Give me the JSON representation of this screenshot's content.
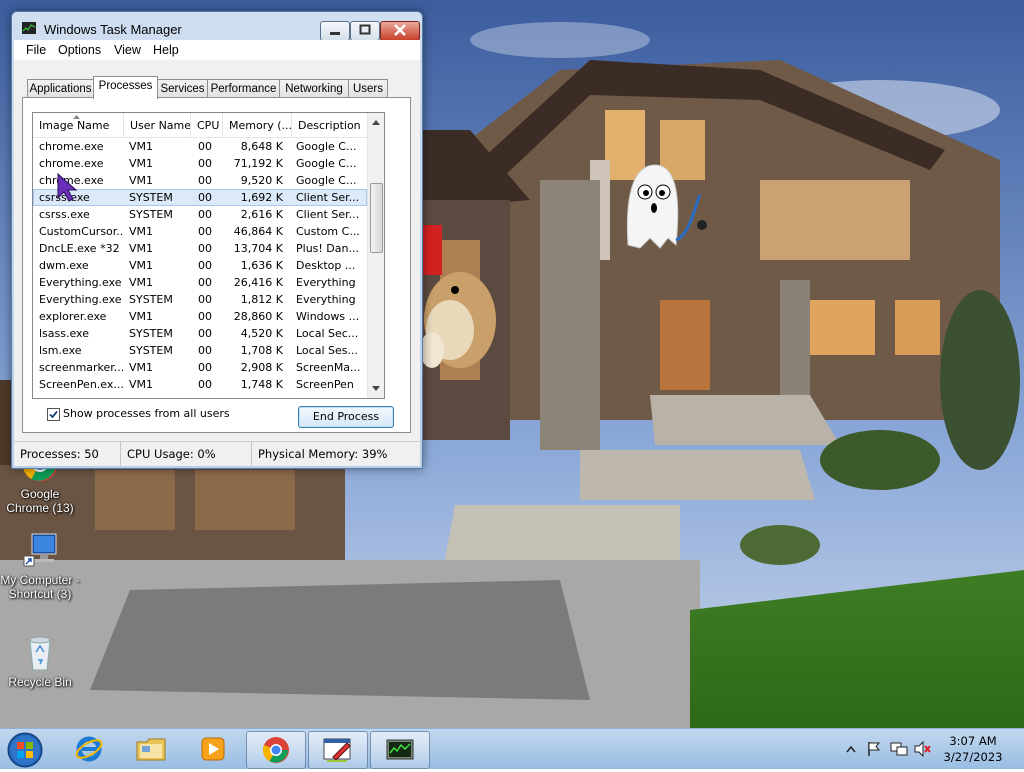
{
  "window": {
    "title": "Windows Task Manager",
    "menu": [
      "File",
      "Options",
      "View",
      "Help"
    ],
    "tabs": [
      "Applications",
      "Processes",
      "Services",
      "Performance",
      "Networking",
      "Users"
    ],
    "active_tab": "Processes"
  },
  "processes": {
    "columns": [
      "Image Name",
      "User Name",
      "CPU",
      "Memory (...",
      "Description"
    ],
    "sort_column": "Image Name",
    "selected_row": 3,
    "rows": [
      {
        "name": "chrome.exe",
        "user": "VM1",
        "cpu": "00",
        "mem": "8,648 K",
        "desc": "Google C..."
      },
      {
        "name": "chrome.exe",
        "user": "VM1",
        "cpu": "00",
        "mem": "71,192 K",
        "desc": "Google C..."
      },
      {
        "name": "chrome.exe",
        "user": "VM1",
        "cpu": "00",
        "mem": "9,520 K",
        "desc": "Google C..."
      },
      {
        "name": "csrss.exe",
        "user": "SYSTEM",
        "cpu": "00",
        "mem": "1,692 K",
        "desc": "Client Ser..."
      },
      {
        "name": "csrss.exe",
        "user": "SYSTEM",
        "cpu": "00",
        "mem": "2,616 K",
        "desc": "Client Ser..."
      },
      {
        "name": "CustomCursor...",
        "user": "VM1",
        "cpu": "00",
        "mem": "46,864 K",
        "desc": "Custom C..."
      },
      {
        "name": "DncLE.exe *32",
        "user": "VM1",
        "cpu": "00",
        "mem": "13,704 K",
        "desc": "Plus! Dan..."
      },
      {
        "name": "dwm.exe",
        "user": "VM1",
        "cpu": "00",
        "mem": "1,636 K",
        "desc": "Desktop ..."
      },
      {
        "name": "Everything.exe",
        "user": "VM1",
        "cpu": "00",
        "mem": "26,416 K",
        "desc": "Everything"
      },
      {
        "name": "Everything.exe",
        "user": "SYSTEM",
        "cpu": "00",
        "mem": "1,812 K",
        "desc": "Everything"
      },
      {
        "name": "explorer.exe",
        "user": "VM1",
        "cpu": "00",
        "mem": "28,860 K",
        "desc": "Windows ..."
      },
      {
        "name": "lsass.exe",
        "user": "SYSTEM",
        "cpu": "00",
        "mem": "4,520 K",
        "desc": "Local Sec..."
      },
      {
        "name": "lsm.exe",
        "user": "SYSTEM",
        "cpu": "00",
        "mem": "1,708 K",
        "desc": "Local Ses..."
      },
      {
        "name": "screenmarker...",
        "user": "VM1",
        "cpu": "00",
        "mem": "2,908 K",
        "desc": "ScreenMa..."
      },
      {
        "name": "ScreenPen.ex...",
        "user": "VM1",
        "cpu": "00",
        "mem": "1,748 K",
        "desc": "ScreenPen"
      }
    ],
    "show_all_label": "Show processes from all users",
    "show_all_checked": true,
    "end_process_label": "End Process"
  },
  "status_bar": {
    "processes": "Processes: 50",
    "cpu": "CPU Usage: 0%",
    "memory": "Physical Memory: 39%"
  },
  "desktop_icons": [
    {
      "label": "Google Chrome (13)",
      "icon": "chrome-icon"
    },
    {
      "label": "My Computer - Shortcut (3)",
      "icon": "computer-icon"
    },
    {
      "label": "Recycle Bin",
      "icon": "recycle-bin-icon"
    }
  ],
  "taskbar": {
    "pinned": [
      "internet-explorer-icon",
      "folder-icon",
      "media-player-icon",
      "chrome-icon",
      "screen-marker-icon",
      "task-manager-icon"
    ],
    "clock_time": "3:07 AM",
    "clock_date": "3/27/2023"
  },
  "colors": {
    "selection": "#dbe9f9",
    "taskbar": "#99bde3",
    "title_bar": "#b9cfe8"
  }
}
